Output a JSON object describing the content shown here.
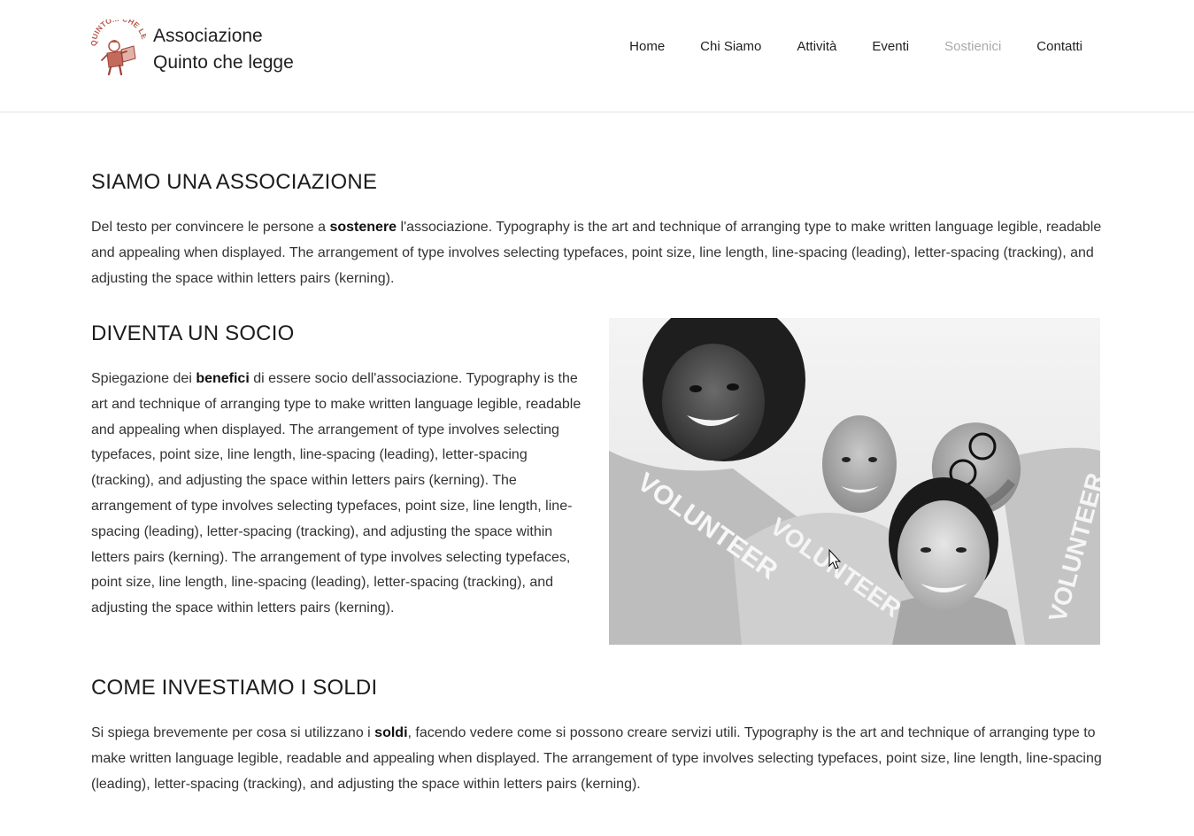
{
  "brand": {
    "logo_text": "QUINTO... CHE LEGGE",
    "name_line1": "Associazione",
    "name_line2": "Quinto che legge"
  },
  "nav": {
    "items": [
      {
        "label": "Home",
        "active": false
      },
      {
        "label": "Chi Siamo",
        "active": false
      },
      {
        "label": "Attività",
        "active": false
      },
      {
        "label": "Eventi",
        "active": false
      },
      {
        "label": "Sostienici",
        "active": true
      },
      {
        "label": "Contatti",
        "active": false
      }
    ],
    "active_color": "#a9a9a9"
  },
  "sections": [
    {
      "title": "SIAMO UNA ASSOCIAZIONE",
      "text_before": "Del testo per convincere le persone a ",
      "bold": "sostenere",
      "text_after": " l'associazione. Typography is the art and technique of arranging type to make written language legible, readable and appealing when displayed. The arrangement of type involves selecting typefaces, point size, line length, line-spacing (leading), letter-spacing (tracking), and adjusting the space within letters pairs (kerning)."
    },
    {
      "title": "DIVENTA UN SOCIO",
      "text_before": "Spiegazione dei ",
      "bold": "benefici",
      "text_after": " di essere socio dell'associazione. Typography is the art and technique of arranging type to make written language legible, readable and appealing when displayed. The arrangement of type involves selecting typefaces, point size, line length, line-spacing (leading), letter-spacing (tracking), and adjusting the space within letters pairs (kerning). The arrangement of type involves selecting typefaces, point size, line length, line-spacing (leading), letter-spacing (tracking), and adjusting the space within letters pairs (kerning). The arrangement of type involves selecting typefaces, point size, line length, line-spacing (leading), letter-spacing (tracking), and adjusting the space within letters pairs (kerning)."
    },
    {
      "title": "COME INVESTIAMO I SOLDI",
      "text_before": "Si spiega brevemente per cosa si utilizzano i ",
      "bold": "soldi",
      "text_after": ", facendo vedere come si possono creare servizi utili. Typography is the art and technique of arranging type to make written language legible, readable and appealing when displayed. The arrangement of type involves selecting typefaces, point size, line length, line-spacing (leading), letter-spacing (tracking), and adjusting the space within letters pairs (kerning)."
    }
  ],
  "photo": {
    "shirt_text_1": "VOLUNTEER",
    "shirt_text_2": "VOLUNTEER",
    "shirt_text_3": "VOLUNTEER"
  },
  "colors": {
    "logo": "#b5584a",
    "text": "#333333",
    "header_border": "#e3e3e3"
  }
}
